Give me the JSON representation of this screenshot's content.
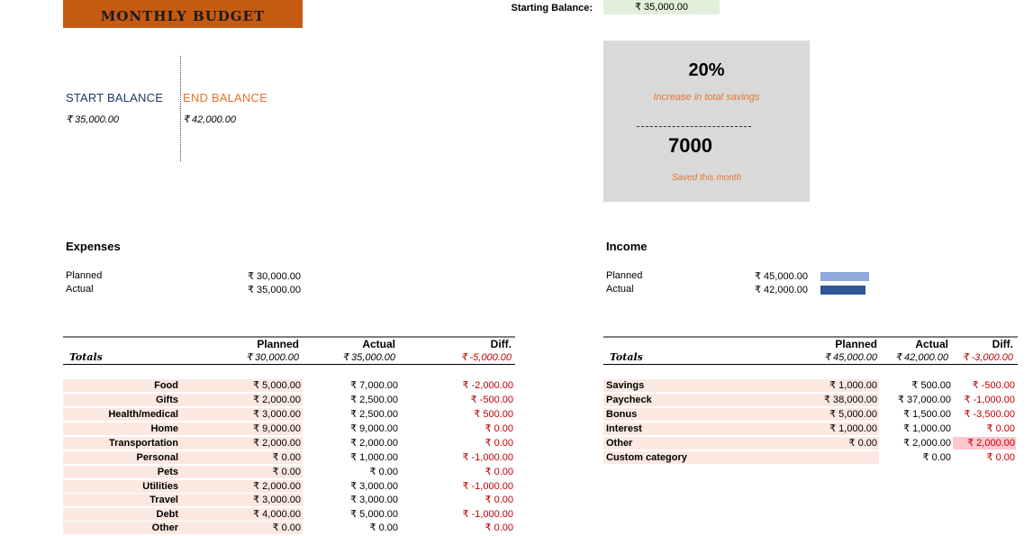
{
  "title": "MONTHLY BUDGET",
  "starting_balance": {
    "label": "Starting Balance:",
    "value": "₹ 35,000.00"
  },
  "balances": {
    "start_label": "START BALANCE",
    "start_value": "₹ 35,000.00",
    "end_label": "END BALANCE",
    "end_value": "₹ 42,000.00"
  },
  "savings": {
    "percent": "20%",
    "percent_caption": "Increase in total savings",
    "amount": "7000",
    "amount_caption": "Saved this month"
  },
  "expenses_summary": {
    "heading": "Expenses",
    "planned_label": "Planned",
    "planned_value": "₹ 30,000.00",
    "actual_label": "Actual",
    "actual_value": "₹ 35,000.00"
  },
  "income_summary": {
    "heading": "Income",
    "planned_label": "Planned",
    "planned_value": "₹ 45,000.00",
    "actual_label": "Actual",
    "actual_value": "₹ 42,000.00",
    "planned_bar_fraction": 1.0,
    "actual_bar_fraction": 0.9333,
    "planned_bar_color": "#8ea9db",
    "actual_bar_color": "#2f5597"
  },
  "expenses_table": {
    "headers": {
      "planned": "Planned",
      "actual": "Actual",
      "diff": "Diff."
    },
    "totals": {
      "label": "Totals",
      "planned": "₹ 30,000.00",
      "actual": "₹ 35,000.00",
      "diff": "₹ -5,000.00"
    },
    "rows": [
      {
        "category": "Food",
        "planned": "₹ 5,000.00",
        "actual": "₹ 7,000.00",
        "diff": "₹ -2,000.00"
      },
      {
        "category": "Gifts",
        "planned": "₹ 2,000.00",
        "actual": "₹ 2,500.00",
        "diff": "₹ -500.00"
      },
      {
        "category": "Health/medical",
        "planned": "₹ 3,000.00",
        "actual": "₹ 2,500.00",
        "diff": "₹ 500.00"
      },
      {
        "category": "Home",
        "planned": "₹ 9,000.00",
        "actual": "₹ 9,000.00",
        "diff": "₹ 0.00"
      },
      {
        "category": "Transportation",
        "planned": "₹ 2,000.00",
        "actual": "₹ 2,000.00",
        "diff": "₹ 0.00"
      },
      {
        "category": "Personal",
        "planned": "₹ 0.00",
        "actual": "₹ 1,000.00",
        "diff": "₹ -1,000.00"
      },
      {
        "category": "Pets",
        "planned": "₹ 0.00",
        "actual": "₹ 0.00",
        "diff": "₹ 0.00"
      },
      {
        "category": "Utilities",
        "planned": "₹ 2,000.00",
        "actual": "₹ 3,000.00",
        "diff": "₹ -1,000.00"
      },
      {
        "category": "Travel",
        "planned": "₹ 3,000.00",
        "actual": "₹ 3,000.00",
        "diff": "₹ 0.00"
      },
      {
        "category": "Debt",
        "planned": "₹ 4,000.00",
        "actual": "₹ 5,000.00",
        "diff": "₹ -1,000.00"
      },
      {
        "category": "Other",
        "planned": "₹ 0.00",
        "actual": "₹ 0.00",
        "diff": "₹ 0.00"
      }
    ]
  },
  "income_table": {
    "headers": {
      "planned": "Planned",
      "actual": "Actual",
      "diff": "Diff."
    },
    "totals": {
      "label": "Totals",
      "planned": "₹ 45,000.00",
      "actual": "₹ 42,000.00",
      "diff": "₹ -3,000.00"
    },
    "rows": [
      {
        "category": "Savings",
        "planned": "₹ 1,000.00",
        "actual": "₹ 500.00",
        "diff": "₹ -500.00"
      },
      {
        "category": "Paycheck",
        "planned": "₹ 38,000.00",
        "actual": "₹ 37,000.00",
        "diff": "₹ -1,000.00"
      },
      {
        "category": "Bonus",
        "planned": "₹ 5,000.00",
        "actual": "₹ 1,500.00",
        "diff": "₹ -3,500.00"
      },
      {
        "category": "Interest",
        "planned": "₹ 1,000.00",
        "actual": "₹ 1,000.00",
        "diff": "₹ 0.00"
      },
      {
        "category": "Other",
        "planned": "₹ 0.00",
        "actual": "₹ 2,000.00",
        "diff": "₹ 2,000.00"
      },
      {
        "category": "Custom category",
        "planned": "",
        "actual": "₹ 0.00",
        "diff": "₹ 0.00"
      }
    ]
  }
}
